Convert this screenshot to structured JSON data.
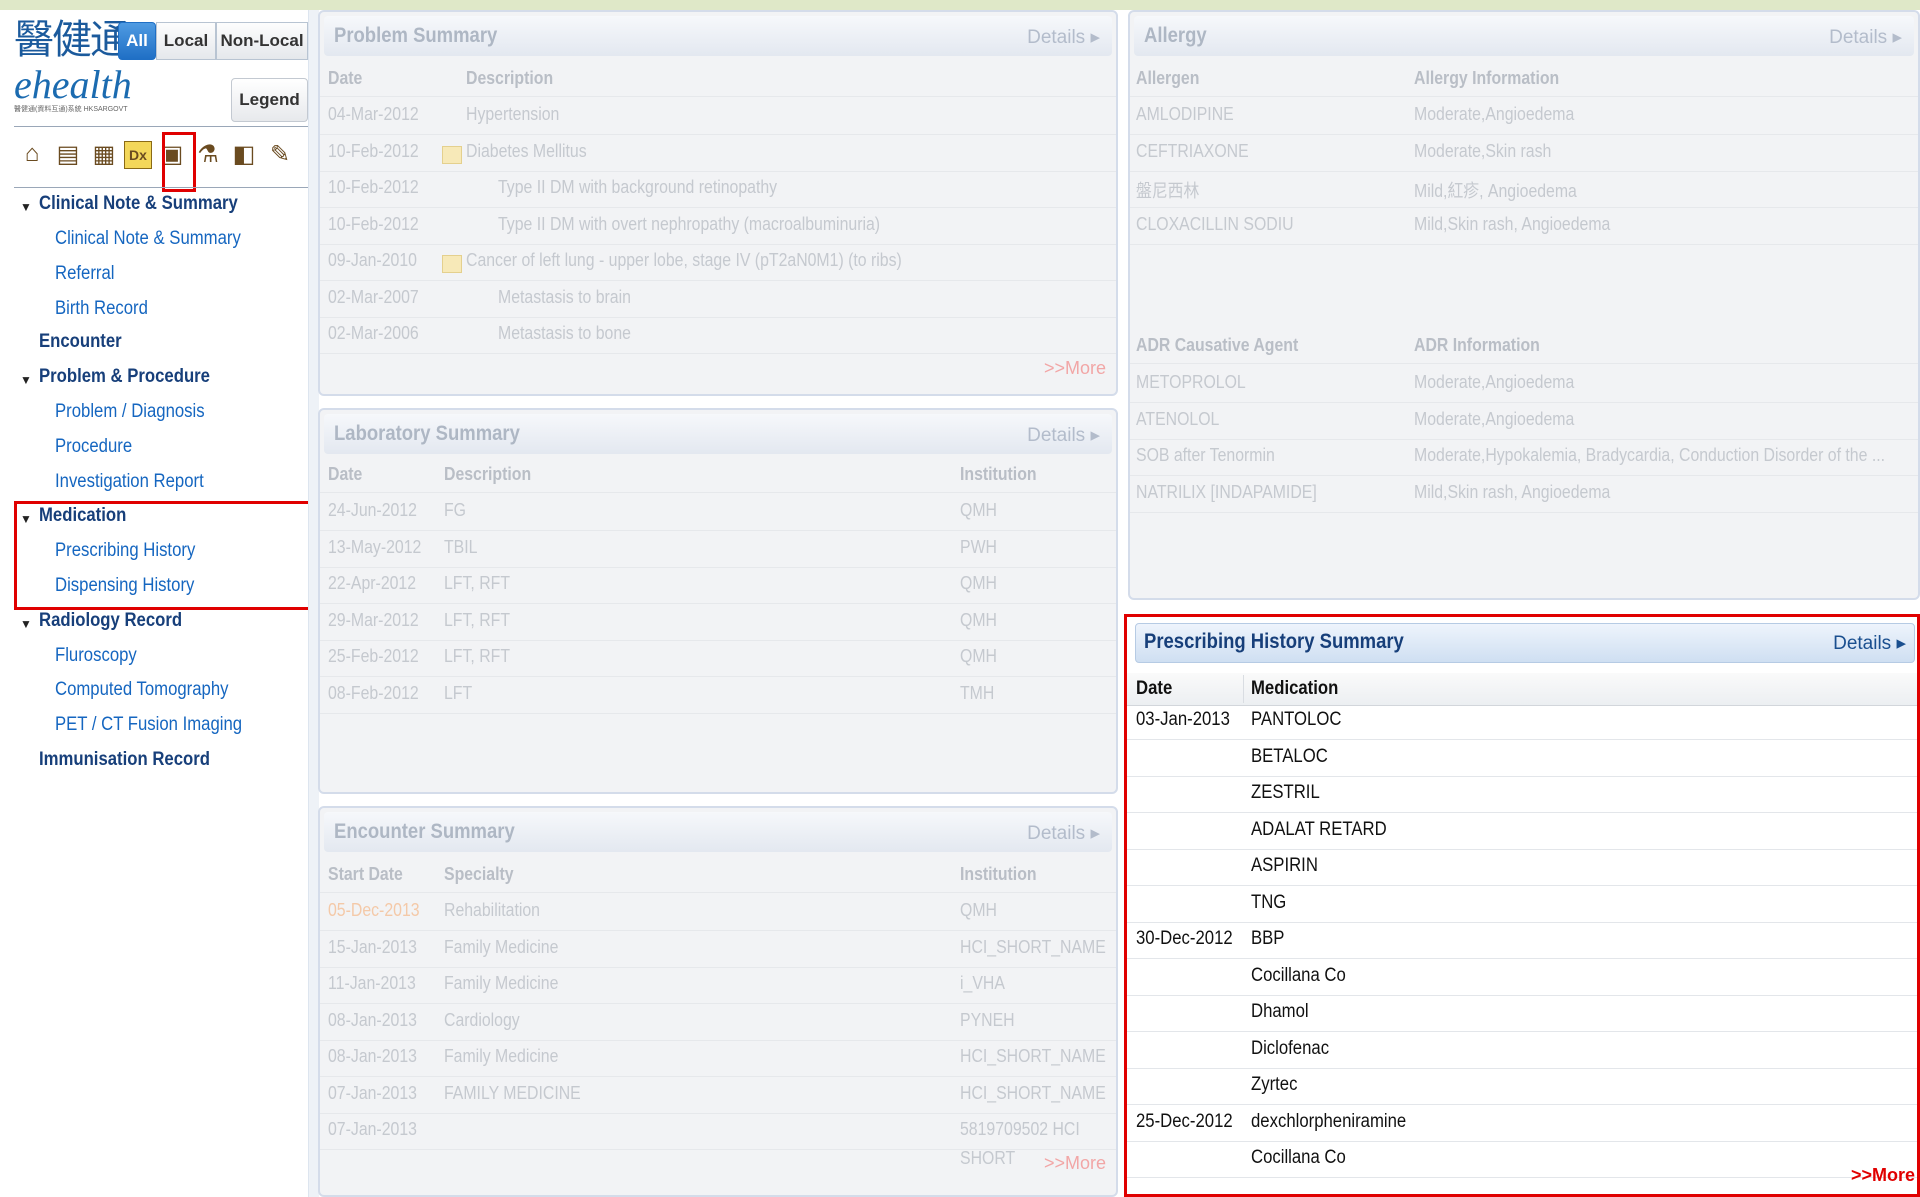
{
  "app": {
    "logo_chinese": "醫健通",
    "logo_english": "ehealth",
    "logo_sub": "醫健通(資料互通)系統 HKSARGOVT"
  },
  "filters": {
    "all": "All",
    "local": "Local",
    "nonlocal": "Non-Local",
    "legend": "Legend"
  },
  "toolbar_icons": [
    "home-icon",
    "clinical-note-icon",
    "calendar-icon",
    "diagnosis-dx-icon",
    "medication-icon",
    "laboratory-icon",
    "radiology-icon",
    "pen-icon"
  ],
  "nav": {
    "clinical_group": "Clinical Note & Summary",
    "clinical_items": [
      "Clinical Note & Summary",
      "Referral",
      "Birth Record"
    ],
    "encounter": "Encounter",
    "problem_group": "Problem & Procedure",
    "problem_items": [
      "Problem / Diagnosis",
      "Procedure",
      "Investigation Report"
    ],
    "medication_group": "Medication",
    "medication_items": [
      "Prescribing History",
      "Dispensing History"
    ],
    "radiology_group": "Radiology Record",
    "radiology_items": [
      "Fluroscopy",
      "Computed Tomography",
      "PET / CT Fusion Imaging"
    ],
    "immunisation": "Immunisation Record",
    "triangle": "▼"
  },
  "problem": {
    "title": "Problem Summary",
    "details": "Details ▸",
    "col_date": "Date",
    "col_desc": "Description",
    "rows": [
      {
        "date": "04-Mar-2012",
        "desc": "Hypertension"
      },
      {
        "date": "10-Feb-2012",
        "desc": "Diabetes Mellitus"
      },
      {
        "date": "10-Feb-2012",
        "desc": "Type II DM with background retinopathy"
      },
      {
        "date": "10-Feb-2012",
        "desc": "Type II DM with overt nephropathy (macroalbuminuria)"
      },
      {
        "date": "09-Jan-2010",
        "desc": "Cancer of left lung - upper lobe, stage IV (pT2aN0M1) (to ribs)"
      },
      {
        "date": "02-Mar-2007",
        "desc": "Metastasis to brain"
      },
      {
        "date": "02-Mar-2006",
        "desc": "Metastasis to bone"
      }
    ],
    "more": ">>More"
  },
  "allergy": {
    "title": "Allergy",
    "details": "Details ▸",
    "col_allergen": "Allergen",
    "col_info": "Allergy Information",
    "rows": [
      {
        "name": "AMLODIPINE",
        "info": "Moderate,Angioedema"
      },
      {
        "name": "CEFTRIAXONE",
        "info": "Moderate,Skin rash"
      },
      {
        "name": "盤尼西林",
        "info": "Mild,紅疹, Angioedema"
      },
      {
        "name": "CLOXACILLIN SODIU",
        "info": "Mild,Skin rash, Angioedema"
      }
    ],
    "col_adr_agent": "ADR Causative Agent",
    "col_adr_info": "ADR Information",
    "adr_rows": [
      {
        "name": "METOPROLOL",
        "info": "Moderate,Angioedema"
      },
      {
        "name": "ATENOLOL",
        "info": "Moderate,Angioedema"
      },
      {
        "name": "SOB after Tenormin",
        "info": "Moderate,Hypokalemia, Bradycardia, Conduction Disorder of the ..."
      },
      {
        "name": "NATRILIX [INDAPAMIDE]",
        "info": "Mild,Skin rash, Angioedema"
      }
    ]
  },
  "lab": {
    "title": "Laboratory Summary",
    "details": "Details ▸",
    "col_date": "Date",
    "col_desc": "Description",
    "col_inst": "Institution",
    "rows": [
      {
        "date": "24-Jun-2012",
        "desc": "FG",
        "inst": "QMH"
      },
      {
        "date": "13-May-2012",
        "desc": "TBIL",
        "inst": "PWH"
      },
      {
        "date": "22-Apr-2012",
        "desc": "LFT, RFT",
        "inst": "QMH"
      },
      {
        "date": "29-Mar-2012",
        "desc": "LFT, RFT",
        "inst": "QMH"
      },
      {
        "date": "25-Feb-2012",
        "desc": "LFT, RFT",
        "inst": "QMH"
      },
      {
        "date": "08-Feb-2012",
        "desc": "LFT",
        "inst": "TMH"
      }
    ]
  },
  "encounter": {
    "title": "Encounter Summary",
    "details": "Details ▸",
    "col_date": "Start Date",
    "col_spec": "Specialty",
    "col_inst": "Institution",
    "rows": [
      {
        "date": "05-Dec-2013",
        "spec": "Rehabilitation",
        "inst": "QMH"
      },
      {
        "date": "15-Jan-2013",
        "spec": "Family Medicine",
        "inst": "HCI_SHORT_NAME"
      },
      {
        "date": "11-Jan-2013",
        "spec": "Family Medicine",
        "inst": "i_VHA"
      },
      {
        "date": "08-Jan-2013",
        "spec": "Cardiology",
        "inst": "PYNEH"
      },
      {
        "date": "08-Jan-2013",
        "spec": "Family Medicine",
        "inst": "HCI_SHORT_NAME"
      },
      {
        "date": "07-Jan-2013",
        "spec": "FAMILY MEDICINE",
        "inst": "HCI_SHORT_NAME"
      },
      {
        "date": "07-Jan-2013",
        "spec": "",
        "inst": "5819709502 HCI"
      }
    ],
    "inst_cont": "SHORT",
    "more": ">>More"
  },
  "prescribing": {
    "title": "Prescribing History Summary",
    "details": "Details ▸",
    "col_date": "Date",
    "col_med": "Medication",
    "rows": [
      {
        "date": "03-Jan-2013",
        "med": "PANTOLOC"
      },
      {
        "date": "",
        "med": "BETALOC"
      },
      {
        "date": "",
        "med": "ZESTRIL"
      },
      {
        "date": "",
        "med": "ADALAT RETARD"
      },
      {
        "date": "",
        "med": "ASPIRIN"
      },
      {
        "date": "",
        "med": "TNG"
      },
      {
        "date": "30-Dec-2012",
        "med": "BBP"
      },
      {
        "date": "",
        "med": "Cocillana Co"
      },
      {
        "date": "",
        "med": "Dhamol"
      },
      {
        "date": "",
        "med": "Diclofenac"
      },
      {
        "date": "",
        "med": "Zyrtec"
      },
      {
        "date": "25-Dec-2012",
        "med": "dexchlorpheniramine"
      },
      {
        "date": "",
        "med": "Cocillana Co"
      }
    ],
    "more": ">>More"
  }
}
